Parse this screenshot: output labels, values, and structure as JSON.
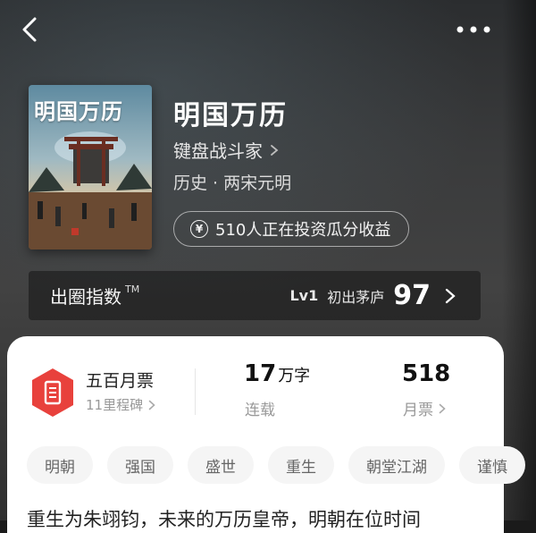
{
  "book": {
    "title": "明国万历",
    "author": "键盘战斗家",
    "genre": "历史 · 两宋元明",
    "cover_text": "明国万历"
  },
  "invest": {
    "text": "510人正在投资瓜分收益",
    "icon": "yen-icon"
  },
  "index": {
    "label": "出圈指数",
    "tm": "TM",
    "level": "Lv1",
    "rank": "初出茅庐",
    "score": "97"
  },
  "stats": {
    "ticket_title": "五百月票",
    "ticket_sub": "11里程碑",
    "words_num": "17",
    "words_unit": "万字",
    "words_label": "连载",
    "votes_num": "518",
    "votes_label": "月票"
  },
  "tags": [
    "明朝",
    "强国",
    "盛世",
    "重生",
    "朝堂江湖",
    "谨慎"
  ],
  "intro": "重生为朱翊钧，未来的万历皇帝，明朝在位时间",
  "colors": {
    "badge": "#e8413c",
    "card_bg": "#ffffff",
    "tag_bg": "#f5f5f5"
  }
}
